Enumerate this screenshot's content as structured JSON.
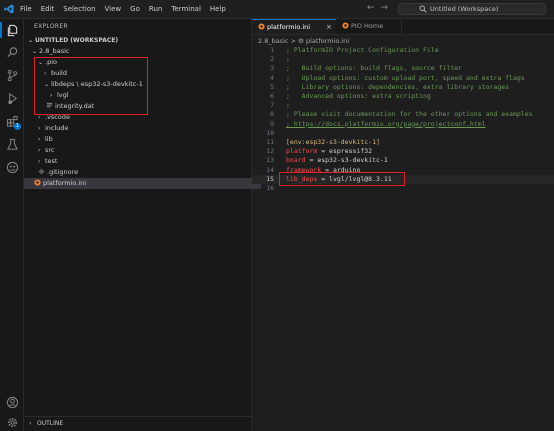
{
  "menu": [
    "File",
    "Edit",
    "Selection",
    "View",
    "Go",
    "Run",
    "Terminal",
    "Help"
  ],
  "search": {
    "text": "Untitled (Workspace)"
  },
  "activity_icons": [
    "explorer-icon",
    "search-icon",
    "source-control-icon",
    "run-debug-icon",
    "extensions-icon",
    "testing-icon",
    "platformio-icon",
    "account-icon",
    "settings-icon"
  ],
  "extensions_badge": "1",
  "sidebar": {
    "title": "EXPLORER",
    "workspace": "UNTITLED (WORKSPACE)",
    "tree": [
      {
        "label": "2.8_basic",
        "chev": "⌄"
      },
      {
        "label": ".pio",
        "chev": "⌄"
      },
      {
        "label": "build",
        "chev": "›"
      },
      {
        "label": "libdeps \\ esp32-s3-devkitc-1",
        "chev": "⌄"
      },
      {
        "label": "lvgl",
        "chev": "›"
      },
      {
        "label": "integrity.dat",
        "chev": ""
      },
      {
        "label": ".vscode",
        "chev": "›"
      },
      {
        "label": "include",
        "chev": "›"
      },
      {
        "label": "lib",
        "chev": "›"
      },
      {
        "label": "src",
        "chev": "›"
      },
      {
        "label": "test",
        "chev": "›"
      },
      {
        "label": ".gitignore",
        "chev": ""
      },
      {
        "label": "platformio.ini",
        "chev": ""
      }
    ],
    "outline": "OUTLINE"
  },
  "tabs": [
    {
      "label": "platformio.ini",
      "close": "×"
    },
    {
      "label": "PIO Home"
    }
  ],
  "breadcrumb": "2.8_basic  >  ⚙ platformio.ini",
  "editor": {
    "lines": [
      {
        "n": "1",
        "t": "; PlatformIO Project Configuration File"
      },
      {
        "n": "2",
        "t": ";"
      },
      {
        "n": "3",
        "t": ";   Build options: build flags, source filter"
      },
      {
        "n": "4",
        "t": ";   Upload options: custom upload port, speed and extra flags"
      },
      {
        "n": "5",
        "t": ";   Library options: dependencies, extra library storages"
      },
      {
        "n": "6",
        "t": ";   Advanced options: extra scripting"
      },
      {
        "n": "7",
        "t": ";"
      },
      {
        "n": "8",
        "t": "; Please visit documentation for the other options and examples"
      },
      {
        "n": "9",
        "t": "; https://docs.platformio.org/page/projectconf.html"
      },
      {
        "n": "10",
        "t": ""
      },
      {
        "n": "11",
        "t": "[env:esp32-s3-devkitc-1]"
      },
      {
        "n": "12",
        "k": "platform",
        "v": " = espressif32"
      },
      {
        "n": "13",
        "k": "board",
        "v": " = esp32-s3-devkitc-1"
      },
      {
        "n": "14",
        "k": "framework",
        "v": " = arduino"
      },
      {
        "n": "15",
        "k": "lib_deps",
        "v": " = lvgl/lvgl@8.3.11"
      },
      {
        "n": "16",
        "t": ""
      }
    ]
  }
}
